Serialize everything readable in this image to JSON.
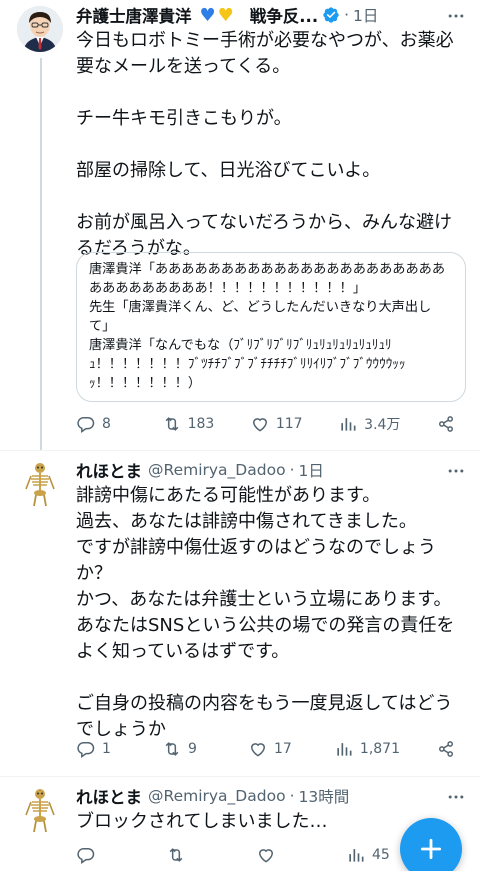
{
  "tweets": [
    {
      "name": "弁護士唐澤貴洋",
      "name_emoji": "💙💛",
      "name_suffix": "戦争反...",
      "handle": "",
      "time": "1日",
      "body": "今日もロボトミー手術が必要なやつが、お薬必要なメールを送ってくる。\n\nチー牛キモ引きこもりが。\n\n部屋の掃除して、日光浴びてこいよ。\n\nお前が風呂入ってないだろうから、みんな避けるだろうがな。",
      "quote": "唐澤貴洋「あああああああああああああああああああああああああああああああ！！！！！！！！！！！」\n先生「唐澤貴洋くん、ど、どうしたんだいきなり大声出して」\n唐澤貴洋「なんでもな（ﾌﾞﾘﾌﾞﾘﾌﾞﾘﾌﾞﾘｭﾘｭﾘｭﾘｭﾘｭﾘｭﾘｭ！！！！！！！ﾌﾞﾂﾁﾁﾌﾞﾌﾞﾌﾞﾁﾁﾁﾁﾌﾞﾘﾘｲﾘﾌﾞﾌﾞﾌﾞｳｳｳｳｯｯｯ！！！！！！！）",
      "actions": {
        "reply": "8",
        "retweet": "183",
        "like": "117",
        "views": "3.4万"
      }
    },
    {
      "name": "れほとま",
      "handle": "@Remirya_Dadoo",
      "time": "1日",
      "body": "誹謗中傷にあたる可能性があります。\n過去、あなたは誹謗中傷されてきました。\nですが誹謗中傷仕返すのはどうなのでしょうか？\nかつ、あなたは弁護士という立場にあります。\nあなたはSNSという公共の場での発言の責任をよく知っているはずです。\n\nご自身の投稿の内容をもう一度見返してはどうでしょうか",
      "actions": {
        "reply": "1",
        "retweet": "9",
        "like": "17",
        "views": "1,871"
      }
    },
    {
      "name": "れほとま",
      "handle": "@Remirya_Dadoo",
      "time": "13時間",
      "body": "ブロックされてしまいました…",
      "actions": {
        "reply": "",
        "retweet": "",
        "like": "",
        "views": "45"
      }
    }
  ],
  "separator": "·",
  "colors": {
    "accent": "#1d9bf0",
    "secondary_text": "#536471",
    "border": "#cfd9de"
  },
  "icons": [
    "reply-icon",
    "retweet-icon",
    "like-icon",
    "views-icon",
    "share-icon",
    "more-icon",
    "verified-badge-icon",
    "compose-plus-icon"
  ]
}
